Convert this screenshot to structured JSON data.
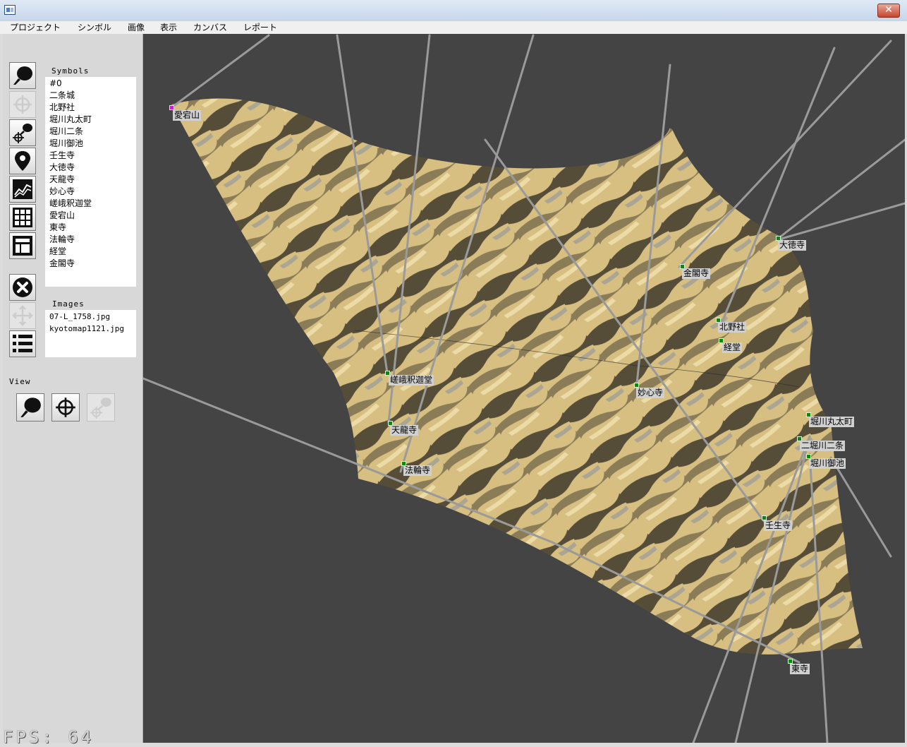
{
  "window": {
    "close_label": "✕",
    "close_color": "#c4462d"
  },
  "menu": [
    "プロジェクト",
    "シンボル",
    "画像",
    "表示",
    "カンバス",
    "レポート"
  ],
  "toolbar_icons": [
    "symbol-brush-icon",
    "crosshair-icon",
    "brush-crosshair-icon",
    "map-pin-icon",
    "line-chart-icon",
    "grid-icon",
    "layout-icon",
    "delete-icon",
    "move-arrows-icon",
    "list-icon"
  ],
  "panels": {
    "symbols_title": "Symbols",
    "symbols": [
      "#0",
      "二条城",
      "北野社",
      "堀川丸太町",
      "堀川二条",
      "堀川御池",
      "壬生寺",
      "大徳寺",
      "天龍寺",
      "妙心寺",
      "嵯峨釈迦堂",
      "愛宕山",
      "東寺",
      "法輪寺",
      "経堂",
      "金閣寺"
    ],
    "images_title": "Images",
    "images": [
      "07-L_1758.jpg",
      "kyotomap1121.jpg"
    ],
    "view_title": "View"
  },
  "canvas": {
    "background": "#444444",
    "labels": [
      {
        "text": "愛宕山",
        "selected": true
      },
      {
        "text": "大徳寺"
      },
      {
        "text": "金閣寺"
      },
      {
        "text": "北野社"
      },
      {
        "text": "経堂"
      },
      {
        "text": "嵯峨釈迦堂"
      },
      {
        "text": "妙心寺"
      },
      {
        "text": "堀川丸太町"
      },
      {
        "text": "二堀川二条"
      },
      {
        "text": "堀川御池"
      },
      {
        "text": "天龍寺"
      },
      {
        "text": "法輪寺"
      },
      {
        "text": "壬生寺"
      },
      {
        "text": "東寺"
      }
    ]
  },
  "status": {
    "fps": "FPS: 64"
  }
}
